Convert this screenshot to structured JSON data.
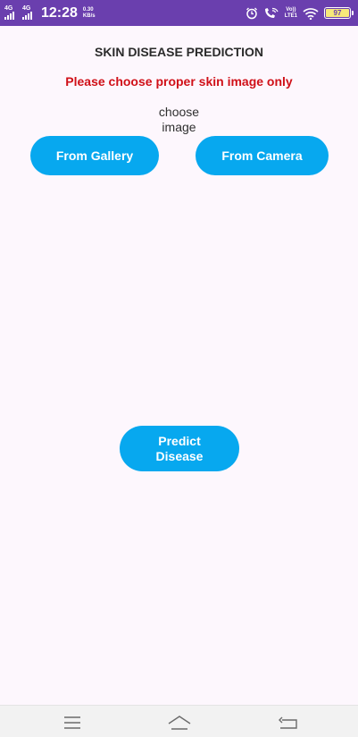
{
  "status_bar": {
    "network1": "4G",
    "network2": "4G",
    "time": "12:28",
    "speed_value": "0.30",
    "speed_unit": "KB/s",
    "volte_top": "Vo))",
    "volte_bottom": "LTE1",
    "battery": "97",
    "icons": [
      "alarm-icon",
      "wifi-call-icon",
      "volte-icon",
      "wifi-icon",
      "battery-icon"
    ],
    "color": "#6a3fae"
  },
  "header": {
    "title": "SKIN DISEASE PREDICTION",
    "warning": "Please choose proper skin image only"
  },
  "image_picker": {
    "prompt": "choose\nimage",
    "gallery_label": "From Gallery",
    "camera_label": "From Camera"
  },
  "actions": {
    "predict_label": "Predict\nDisease"
  },
  "nav_bar": {
    "icons": [
      "menu-icon",
      "home-icon",
      "back-icon"
    ]
  },
  "colors": {
    "accent": "#07a8ef",
    "warning": "#d01018",
    "background": "#fdf7fd"
  }
}
